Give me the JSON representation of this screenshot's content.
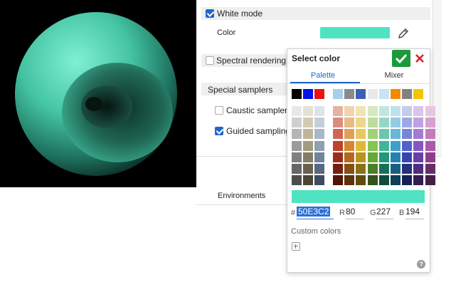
{
  "white_mode": {
    "label": "White mode",
    "checked": true
  },
  "color_row": {
    "label": "Color",
    "value_hex": "#50E3C2"
  },
  "spectral": {
    "label": "Spectral rendering",
    "checked": false
  },
  "special_samplers": {
    "header": "Special samplers"
  },
  "caustic": {
    "label": "Caustic sampler",
    "checked": false
  },
  "guided": {
    "label": "Guided sampling",
    "checked": true
  },
  "environments": {
    "label": "Environments"
  },
  "select_color": {
    "title": "Select color",
    "tabs": [
      {
        "label": "Palette",
        "active": true
      },
      {
        "label": "Mixer",
        "active": false
      }
    ],
    "hex_label": "#",
    "hex_value": "50E3C2",
    "r_label": "R",
    "r_value": "80",
    "g_label": "G",
    "g_value": "227",
    "b_label": "B",
    "b_value": "194",
    "custom_colors_label": "Custom colors",
    "help_glyph": "?",
    "selected_color": "#50E3C2",
    "top_row_left": [
      "#000000",
      "#0011ee",
      "#ee1111"
    ],
    "top_row_right": [
      "#a6cfea",
      "#8a8a8a",
      "#3e5fb3",
      "#e9e9e9",
      "#c6e3f7",
      "#f28a00",
      "#808080",
      "#f5c400"
    ],
    "grid_left": [
      [
        "#e8e8e8",
        "#e6e2d3",
        "#dde3ea"
      ],
      [
        "#cfcfcf",
        "#d2cbb4",
        "#c3cfdc"
      ],
      [
        "#b5b5b5",
        "#bdb49a",
        "#a9b8c7"
      ],
      [
        "#9b9b9b",
        "#a39a80",
        "#8e9fb1"
      ],
      [
        "#808080",
        "#857c66",
        "#70849a"
      ],
      [
        "#666666",
        "#686151",
        "#56697e"
      ],
      [
        "#4d4d4d",
        "#4a4538",
        "#3d4c5e"
      ]
    ],
    "grid_right": [
      [
        "#e7b2a6",
        "#f0d4ad",
        "#f1e4b3",
        "#d5e8bf",
        "#bfe6dc",
        "#bfe0ee",
        "#c5cbee",
        "#d9c4ec",
        "#e8c5e1"
      ],
      [
        "#dc8c7e",
        "#e8bb83",
        "#ecd889",
        "#bcdd9b",
        "#95d7c5",
        "#94cbe3",
        "#9ea8e3",
        "#bfa0e0",
        "#d6a1cf"
      ],
      [
        "#d06552",
        "#e0a059",
        "#e5c95f",
        "#a1d276",
        "#6ac7ae",
        "#6ab6d8",
        "#7784d8",
        "#a37bd3",
        "#c37bbc"
      ],
      [
        "#c1412b",
        "#d6862f",
        "#ddb935",
        "#86c551",
        "#3fb797",
        "#3f9fcc",
        "#5061cc",
        "#8656c6",
        "#ae57a8"
      ],
      [
        "#9a2e1d",
        "#b0691d",
        "#b89520",
        "#68a638",
        "#23967a",
        "#2582ad",
        "#3545a9",
        "#6a3ea7",
        "#8c3f89"
      ],
      [
        "#741f12",
        "#854e13",
        "#8b7015",
        "#4d7d28",
        "#176f5a",
        "#195f80",
        "#24317d",
        "#4f2d7c",
        "#672e66"
      ],
      [
        "#4f140b",
        "#5a330b",
        "#5e4b0d",
        "#33531a",
        "#0e4b3c",
        "#0f3f56",
        "#162053",
        "#341d53",
        "#451e44"
      ]
    ]
  }
}
